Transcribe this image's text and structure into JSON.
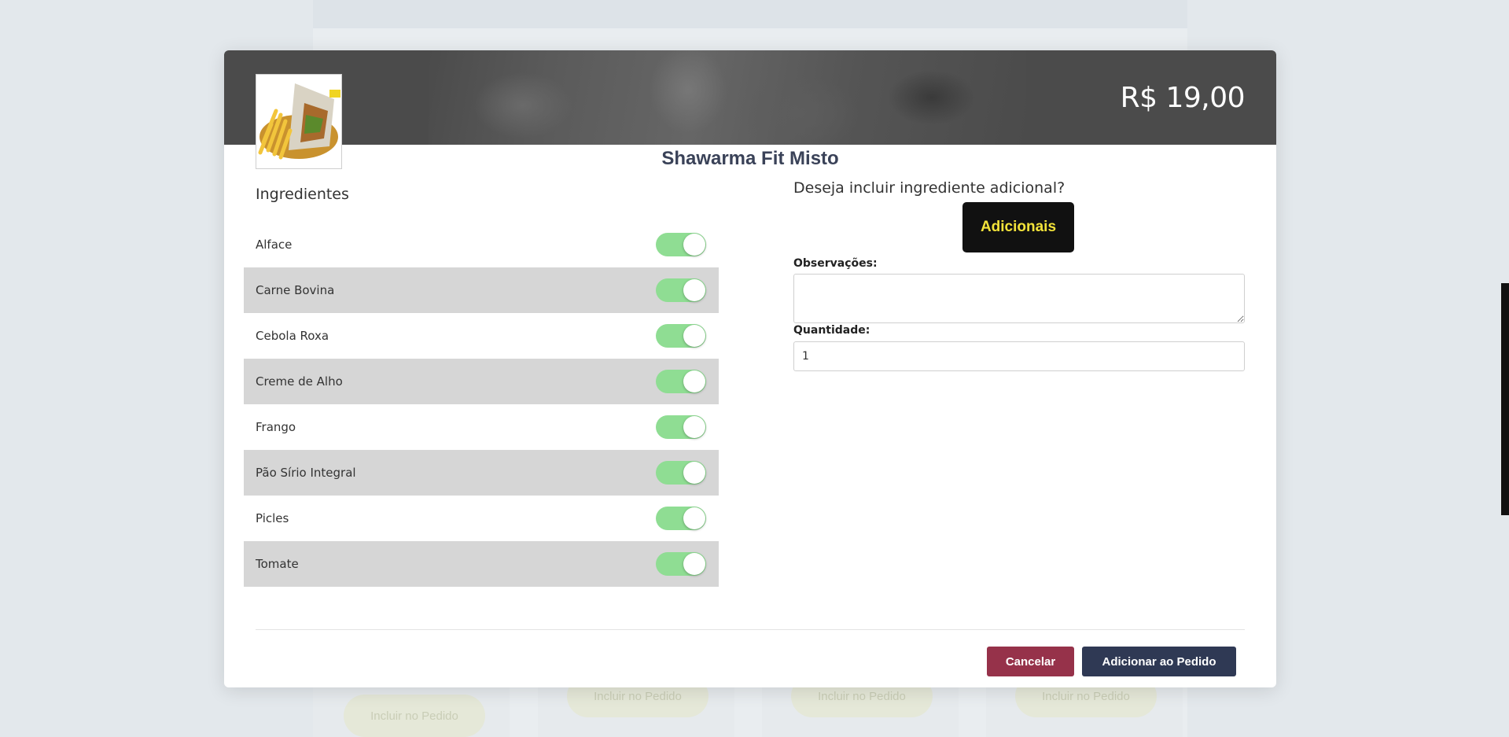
{
  "background": {
    "include_buttons": [
      "Incluir no Pedido",
      "Incluir no Pedido",
      "Incluir no Pedido",
      "Incluir no Pedido"
    ]
  },
  "modal": {
    "price": "R$ 19,00",
    "title": "Shawarma Fit Misto",
    "ingredients_heading": "Ingredientes",
    "ingredients": [
      {
        "label": "Alface",
        "enabled": true
      },
      {
        "label": "Carne Bovina",
        "enabled": true
      },
      {
        "label": "Cebola Roxa",
        "enabled": true
      },
      {
        "label": "Creme de Alho",
        "enabled": true
      },
      {
        "label": "Frango",
        "enabled": true
      },
      {
        "label": "Pão Sírio Integral",
        "enabled": true
      },
      {
        "label": "Picles",
        "enabled": true
      },
      {
        "label": "Tomate",
        "enabled": true
      }
    ],
    "extras_question": "Deseja incluir ingrediente adicional?",
    "extras_button": "Adicionais",
    "observations_label": "Observações:",
    "observations_value": "",
    "quantity_label": "Quantidade:",
    "quantity_value": "1",
    "cancel_label": "Cancelar",
    "add_label": "Adicionar ao Pedido"
  },
  "colors": {
    "toggle_on": "#8fdd93",
    "cancel": "#96324a",
    "primary": "#2f3954",
    "extras_text": "#f3e33a"
  }
}
